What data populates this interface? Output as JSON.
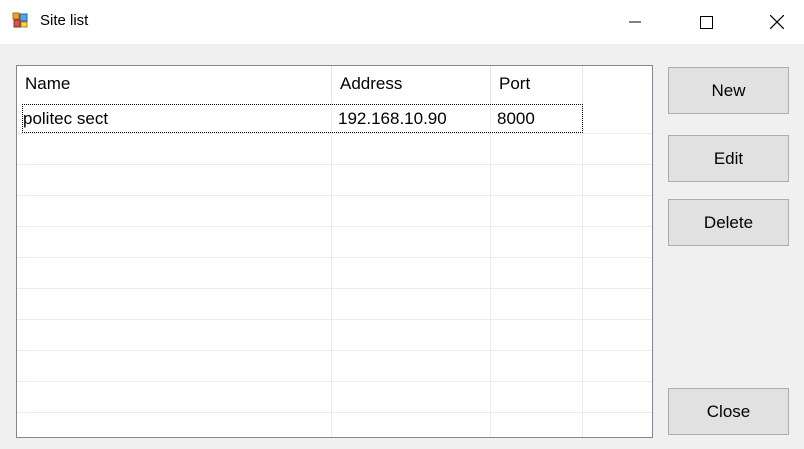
{
  "window": {
    "title": "Site list"
  },
  "list": {
    "columns": [
      "Name",
      "Address",
      "Port"
    ],
    "rows": [
      {
        "name": "politec sect",
        "address": "192.168.10.90",
        "port": "8000"
      }
    ]
  },
  "buttons": {
    "new": "New",
    "edit": "Edit",
    "delete": "Delete",
    "close": "Close"
  }
}
